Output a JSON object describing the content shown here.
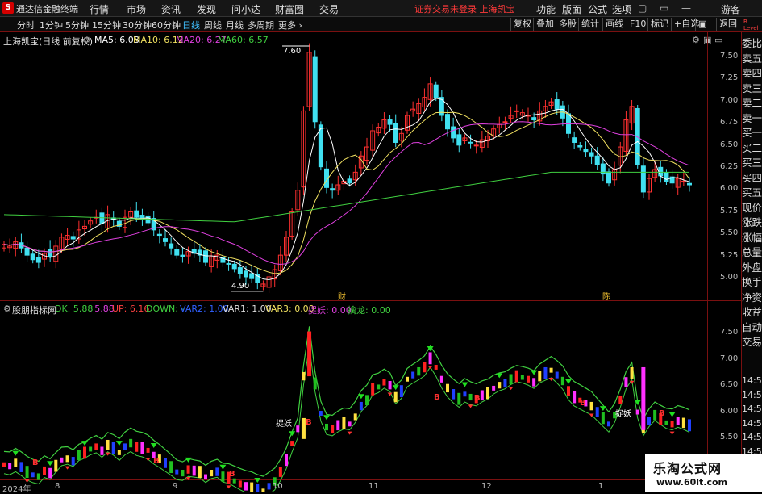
{
  "menubar": {
    "logo": "S",
    "app_title": "通达信金融终端",
    "items": [
      "行情",
      "市场",
      "资讯",
      "发现",
      "问小达",
      "财富圈",
      "交易"
    ],
    "notice": "证券交易未登录  上海凯宝",
    "right_items": [
      "功能",
      "版面",
      "公式",
      "选项"
    ],
    "guest": "游客"
  },
  "toolbar": {
    "periods": [
      "分时",
      "1分钟",
      "5分钟",
      "15分钟",
      "30分钟",
      "60分钟",
      "日线",
      "周线",
      "月线",
      "多周期",
      "更多 ›"
    ],
    "right": [
      "复权",
      "叠加",
      "多股",
      "统计",
      "画线",
      "F10",
      "标记",
      "+自选",
      "返回"
    ]
  },
  "main_info": {
    "title": "上海凯宝(日线 前复权)",
    "ma5": "MA5: 6.08",
    "ma10": "MA10: 6.12",
    "ma20": "MA20: 6.27",
    "ma60": "MA60: 6.57"
  },
  "main_chart": {
    "high_label": "7.60",
    "low_label": "4.90",
    "marks": [
      "财",
      "陈"
    ]
  },
  "main_axis": [
    "7.50",
    "7.25",
    "7.00",
    "6.75",
    "6.50",
    "6.25",
    "6.00",
    "5.75",
    "5.50",
    "5.25",
    "5.00"
  ],
  "ind_info": {
    "name": "股朋指标网",
    "dk": "DK: 5.88",
    "v2": ": 5.88",
    "up": "UP: 6.16",
    "down": "DOWN: -",
    "var2": "VAR2: 1.00",
    "var1": "VAR1: 1.00",
    "var3": "VAR3: 0.00",
    "zy": "捉妖: 0.00",
    "qinlong": "擒龙: 0.00"
  },
  "ind_chart": {
    "tags": [
      "捉妖",
      "捉妖"
    ],
    "b_marks": [
      "B",
      "B",
      "B",
      "B",
      "B",
      "B",
      "B",
      "B"
    ]
  },
  "ind_axis": [
    "7.50",
    "7.00",
    "6.50",
    "6.00",
    "5.50"
  ],
  "side_panel": [
    "委比",
    "卖五",
    "卖四",
    "卖三",
    "卖二",
    "卖一",
    "买一",
    "买二",
    "买三",
    "买四",
    "买五",
    "现价",
    "涨跌",
    "涨幅",
    "总量",
    "外盘",
    "换手",
    "净资",
    "收益",
    "自动",
    "交易"
  ],
  "side_time": [
    "14:56",
    "14:56",
    "14:56",
    "14:56",
    "14:56",
    "14:56",
    "14:56"
  ],
  "badge": {
    "b": "B",
    "level": "Level"
  },
  "date_axis": [
    "2024年",
    "8",
    "9",
    "10",
    "11",
    "12",
    "1"
  ],
  "watermark": {
    "line1": "乐淘公式网",
    "line2": "www.60lt.com"
  },
  "colors": {
    "up": "#ff3030",
    "down": "#40e0f0",
    "ma5": "#ffffff",
    "ma10": "#f0e060",
    "ma20": "#e040e0",
    "ma60": "#40d040",
    "frame": "#7a1010"
  },
  "chart_data": {
    "type": "candlestick",
    "title": "上海凯宝(日线 前复权)",
    "ylim": [
      4.8,
      7.7
    ],
    "xlabels": [
      "2024年",
      "8",
      "9",
      "10",
      "11",
      "12",
      "1"
    ],
    "close": [
      5.42,
      5.4,
      5.45,
      5.38,
      5.3,
      5.25,
      5.22,
      5.32,
      5.28,
      5.4,
      5.5,
      5.52,
      5.48,
      5.58,
      5.62,
      5.68,
      5.72,
      5.65,
      5.75,
      5.7,
      5.62,
      5.72,
      5.78,
      5.72,
      5.7,
      5.66,
      5.58,
      5.52,
      5.45,
      5.38,
      5.3,
      5.28,
      5.34,
      5.32,
      5.3,
      5.22,
      5.28,
      5.3,
      5.22,
      5.2,
      5.15,
      5.1,
      5.06,
      5.04,
      5.0,
      4.98,
      5.06,
      5.14,
      5.3,
      5.5,
      5.78,
      6.02,
      6.9,
      7.55,
      6.78,
      6.28,
      6.05,
      6.02,
      6.08,
      6.12,
      6.1,
      6.22,
      6.4,
      6.5,
      6.68,
      6.72,
      6.8,
      6.75,
      6.55,
      6.65,
      6.85,
      6.92,
      6.98,
      7.05,
      7.2,
      7.05,
      6.85,
      6.7,
      6.6,
      6.52,
      6.6,
      6.55,
      6.52,
      6.58,
      6.62,
      6.7,
      6.75,
      6.78,
      6.85,
      6.9,
      6.88,
      6.85,
      6.8,
      6.9,
      6.95,
      7.0,
      6.92,
      6.82,
      6.65,
      6.55,
      6.5,
      6.45,
      6.4,
      6.3,
      6.2,
      6.1,
      6.25,
      6.5,
      6.8,
      6.95,
      6.3,
      6.0,
      6.15,
      6.25,
      6.18,
      6.12,
      6.1,
      6.15,
      6.12,
      6.08
    ]
  }
}
